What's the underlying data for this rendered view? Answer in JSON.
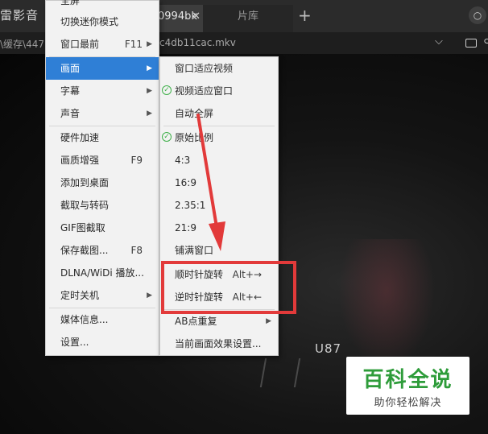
{
  "app": {
    "title": "雷影音"
  },
  "tabs": [
    {
      "label": "0994bk",
      "close": "✕"
    },
    {
      "label": "片库"
    }
  ],
  "new_tab": "+",
  "pathbar": {
    "left_path": "\\缓存\\447",
    "file_name": "c4db11cac.mkv",
    "chevron": "⌵",
    "extra": "⊂"
  },
  "video": {
    "overlay_text": "U87"
  },
  "main_menu": {
    "items": [
      {
        "label": "全屏"
      },
      {
        "label": "切换迷你模式"
      },
      {
        "label": "窗口最前",
        "shortcut": "F11",
        "arrow": "▶"
      },
      {
        "label": "画面",
        "arrow": "▶"
      },
      {
        "label": "字幕",
        "arrow": "▶"
      },
      {
        "label": "声音",
        "arrow": "▶"
      },
      {
        "label": "硬件加速"
      },
      {
        "label": "画质增强",
        "shortcut": "F9"
      },
      {
        "label": "添加到桌面"
      },
      {
        "label": "截取与转码"
      },
      {
        "label": "GIF图截取"
      },
      {
        "label": "保存截图...",
        "shortcut": "F8"
      },
      {
        "label": "DLNA/WiDi 播放..."
      },
      {
        "label": "定时关机",
        "arrow": "▶"
      },
      {
        "label": "媒体信息..."
      },
      {
        "label": "设置..."
      }
    ]
  },
  "sub_menu": {
    "items": [
      {
        "label": "窗口适应视频"
      },
      {
        "label": "视频适应窗口",
        "checked": true
      },
      {
        "label": "自动全屏"
      },
      {
        "label": "原始比例",
        "checked": true
      },
      {
        "label": "4:3"
      },
      {
        "label": "16:9"
      },
      {
        "label": "2.35:1"
      },
      {
        "label": "21:9"
      },
      {
        "label": "铺满窗口"
      },
      {
        "label": "顺时针旋转",
        "shortcut": "Alt+→"
      },
      {
        "label": "逆时针旋转",
        "shortcut": "Alt+←"
      },
      {
        "label": "AB点重复",
        "arrow": "▶"
      },
      {
        "label": "当前画面效果设置..."
      }
    ]
  },
  "watermark": {
    "title": "百科全说",
    "subtitle": "助你轻松解决"
  },
  "colors": {
    "highlight": "#2f7fd6",
    "annotation": "#e23a3a",
    "check": "#3fb04a",
    "watermark": "#2e9c3a"
  }
}
